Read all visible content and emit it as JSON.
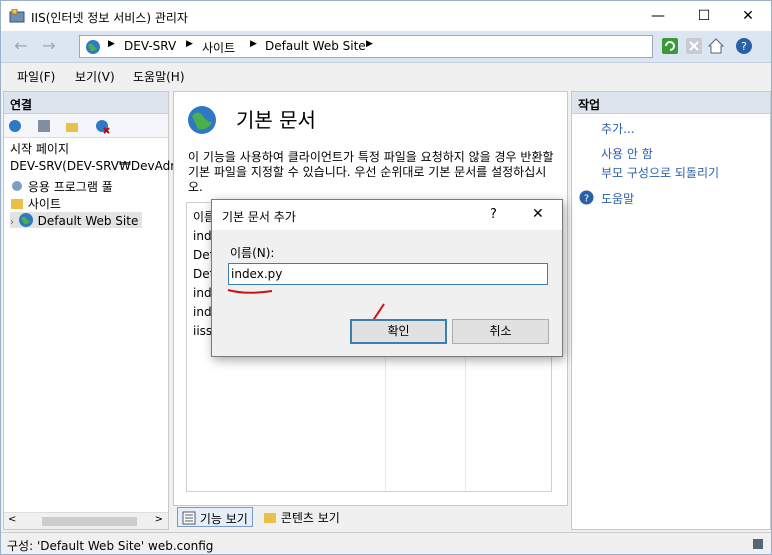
{
  "window": {
    "title": "IIS(인터넷 정보 서비스) 관리자"
  },
  "address": {
    "crumbs": [
      "DEV-SRV",
      "사이트",
      "Default Web Site"
    ]
  },
  "menu": {
    "file": "파일(F)",
    "view": "보기(V)",
    "help": "도움말(H)"
  },
  "connections": {
    "header": "연결",
    "items": [
      "시작 페이지",
      "DEV-SRV(DEV-SRV₩DevAdm",
      "응용 프로그램 풀",
      "사이트",
      "Default Web Site"
    ]
  },
  "main": {
    "title": "기본 문서",
    "description": "이 기능을 사용하여 클라이언트가 특정 파일을 요청하지 않을 경우 반환할 기본 파일을 지정할 수 있습니다. 우선 순위대로 기본 문서를 설정하십시오.",
    "list_header": "이름",
    "list_items": [
      "inde",
      "Def",
      "Def",
      "inde",
      "inde",
      "iisst"
    ],
    "view_tabs": {
      "features": "기능 보기",
      "content": "콘텐츠 보기"
    }
  },
  "actions": {
    "header": "작업",
    "add": "추가...",
    "disable": "사용 안 함",
    "revert": "부모 구성으로 되돌리기",
    "help": "도움말"
  },
  "dialog": {
    "title": "기본 문서 추가",
    "help_glyph": "?",
    "name_label": "이름(N):",
    "name_value": "index.py",
    "ok": "확인",
    "cancel": "취소"
  },
  "status": {
    "text": "구성: 'Default Web Site' web.config"
  }
}
